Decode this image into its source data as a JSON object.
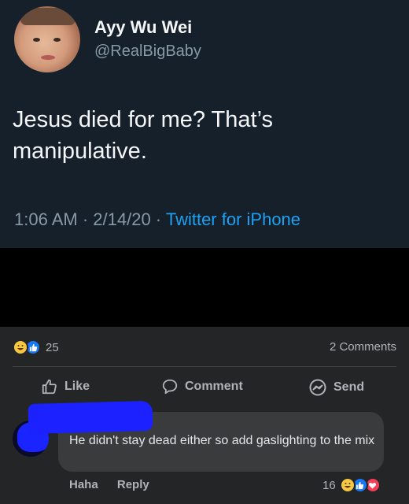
{
  "tweet": {
    "display_name": "Ayy Wu Wei",
    "handle": "@RealBigBaby",
    "text_line1": "Jesus died for me? That’s",
    "text_line2": "manipulative.",
    "time": "1:06 AM",
    "separator": " · ",
    "date": "2/14/20",
    "source": "Twitter for iPhone"
  },
  "fb_post": {
    "reaction_count": "25",
    "comment_count": "2 Comments",
    "actions": {
      "like": "Like",
      "comment": "Comment",
      "send": "Send"
    }
  },
  "comment": {
    "text": "He didn't stay dead either so add gaslighting to the mix",
    "haha_label": "Haha",
    "reply_label": "Reply",
    "reaction_count": "16"
  },
  "colors": {
    "twitter_bg": "#15202b",
    "twitter_link": "#1da1f2",
    "facebook_bg": "#242526",
    "comment_bubble": "#3a3b3c",
    "redaction_blue": "#1b22ff"
  },
  "icons": {
    "reaction_haha": "haha-icon",
    "reaction_like": "like-icon",
    "reaction_love": "love-icon",
    "like_action": "thumbs-up-icon",
    "comment_action": "speech-bubble-icon",
    "send_action": "messenger-icon"
  }
}
